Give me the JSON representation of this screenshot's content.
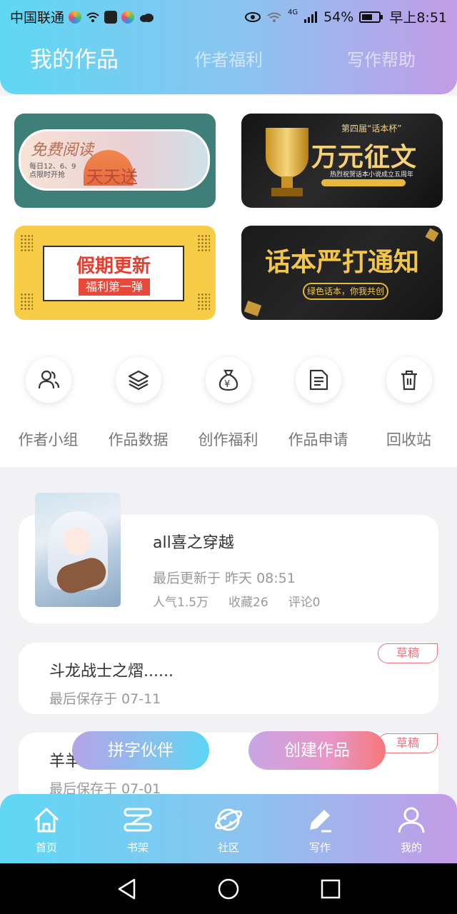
{
  "status_bar": {
    "carrier": "中国联通",
    "network": "4G",
    "battery": "54%",
    "time": "早上8:51"
  },
  "header_tabs": [
    {
      "label": "我的作品",
      "active": true
    },
    {
      "label": "作者福利",
      "active": false
    },
    {
      "label": "写作帮助",
      "active": false
    }
  ],
  "banners": [
    {
      "line1": "免费阅读",
      "line2": "天天送",
      "line3": "每日12、6、9点限时开抢"
    },
    {
      "line1": "第四届“话本杯”",
      "line2": "万元征文",
      "line3": "热烈祝贺话本小说成立五周年"
    },
    {
      "line1": "假期更新",
      "line2": "福利第一弹"
    },
    {
      "line1": "话本严打通知",
      "line2": "绿色话本，你我共创"
    }
  ],
  "quick_actions": [
    {
      "label": "作者小组",
      "icon": "group-icon"
    },
    {
      "label": "作品数据",
      "icon": "layers-icon"
    },
    {
      "label": "创作福利",
      "icon": "money-bag-icon"
    },
    {
      "label": "作品申请",
      "icon": "document-icon"
    },
    {
      "label": "回收站",
      "icon": "trash-icon"
    }
  ],
  "works": {
    "published": {
      "title": "all喜之穿越",
      "updated": "最后更新于 昨天 08:51",
      "popularity": "人气1.5万",
      "favorites": "收藏26",
      "comments": "评论0"
    },
    "drafts": [
      {
        "title": "斗龙战士之熠......",
        "saved": "最后保存于 07-11",
        "tag": "草稿"
      },
      {
        "title": "羊羊",
        "saved": "最后保存于 07-01",
        "tag": "草稿"
      }
    ]
  },
  "floating_buttons": {
    "partner": "拼字伙伴",
    "create": "创建作品"
  },
  "bottom_nav": [
    {
      "label": "首页",
      "icon": "home-icon"
    },
    {
      "label": "书架",
      "icon": "bookshelf-icon"
    },
    {
      "label": "社区",
      "icon": "planet-icon"
    },
    {
      "label": "写作",
      "icon": "pen-icon",
      "active": true
    },
    {
      "label": "我的",
      "icon": "user-icon"
    }
  ],
  "colors": {
    "gradient_start": "#5fd8f4",
    "gradient_end": "#c49be6",
    "draft_tag": "#e8737a"
  }
}
